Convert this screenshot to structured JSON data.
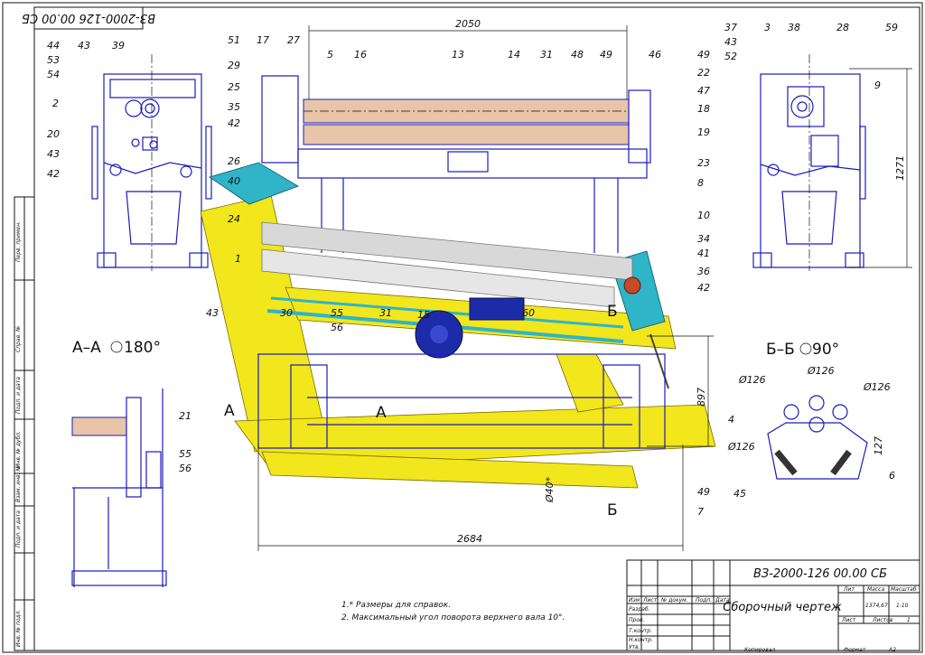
{
  "stamp": {
    "designation": "ВЗ-2000-126 00.00 СБ",
    "designation_mirrored": "ВЗ-2000-126 00.00 СБ",
    "doc_name": "Сборочный чертеж",
    "col_lit": "Лит",
    "col_mass": "Масса",
    "col_scale": "Масштаб",
    "mass_value": "1374,67",
    "scale_value": "1:10",
    "sheet_label": "Лист",
    "sheets_label": "Листов",
    "sheets_value": "1",
    "rows": [
      "Изм",
      "Лист",
      "№ докум.",
      "Подп.",
      "Дата",
      "Разраб.",
      "Пров.",
      "Т.контр.",
      "Н.контр.",
      "Утв."
    ],
    "footer_copy": "Копировал",
    "footer_format": "Формат",
    "format_value": "А2"
  },
  "notes": [
    "1.* Размеры для справок.",
    "2. Максимальный угол поворота верхнего вала 10°."
  ],
  "sections": {
    "aa": "А–А",
    "aa_angle": "180°",
    "bb": "Б–Б",
    "bb_angle": "90°"
  },
  "dimensions": {
    "top_width": "2050",
    "bottom_width": "2684",
    "right_height": "1271",
    "mid_height": "897",
    "bb_small": "127",
    "d126_a": "Ø126",
    "d126_b": "Ø126",
    "d126_c": "Ø126",
    "d126_d": "Ø126",
    "d40": "Ø40*"
  },
  "markers": {
    "a1": "А",
    "a2": "А",
    "b1": "Б",
    "b2": "Б"
  },
  "side_strip": [
    "Перв. примен.",
    "Справ. №",
    "Подп. и дата",
    "Инв. № дубл.",
    "Взам. инв. №",
    "Подп. и дата",
    "Инв. № подл."
  ],
  "callouts": {
    "left_view": [
      "44",
      "53",
      "54",
      "43",
      "39",
      "2",
      "20",
      "43",
      "42"
    ],
    "top_center": [
      "51",
      "17",
      "27",
      "29",
      "25",
      "35",
      "42",
      "26",
      "40",
      "24",
      "5",
      "16",
      "13",
      "14",
      "31",
      "48",
      "49",
      "46",
      "49",
      "22",
      "47",
      "18",
      "19",
      "23",
      "8",
      "10",
      "34",
      "41",
      "36",
      "42"
    ],
    "right_view": [
      "37",
      "43",
      "52",
      "3",
      "38",
      "28",
      "59",
      "9"
    ],
    "lower": [
      "1",
      "43",
      "30",
      "55",
      "56",
      "31",
      "15",
      "60",
      "21",
      "55",
      "56",
      "4",
      "6",
      "45",
      "49",
      "7"
    ]
  }
}
